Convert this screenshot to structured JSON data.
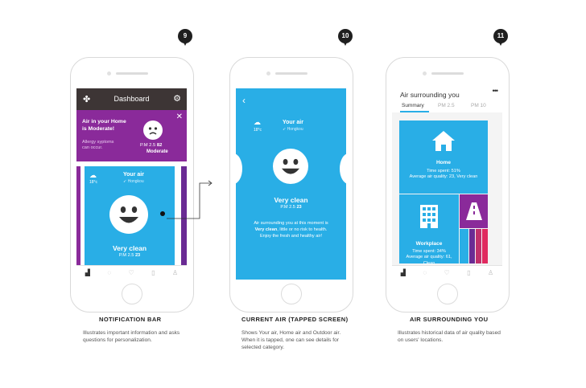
{
  "steps": {
    "s9": "9",
    "s10": "10",
    "s11": "11"
  },
  "screen1": {
    "header_title": "Dashboard",
    "notification": {
      "title": "Air in your Home is Moderate!",
      "body": "Allergy syptoms can occur.",
      "pm_label": "P.M 2.5",
      "pm_value": "82",
      "status": "Moderate"
    },
    "card": {
      "temp": "18°c",
      "label": "Your air",
      "location": "Hongkou",
      "status": "Very clean",
      "pm_label": "P.M 2.5",
      "pm_value": "23"
    }
  },
  "screen2": {
    "temp": "18°c",
    "label": "Your air",
    "location": "Hongkou",
    "status": "Very clean",
    "pm_label": "P.M 2.5",
    "pm_value": "23",
    "description_prefix": "Air surrounding you at this moment is",
    "description_bold": "Very clean",
    "description_suffix": ", little or no risk to health. Enjoy the fresh and healthy air!"
  },
  "screen3": {
    "title": "Air surrounding you",
    "tabs": [
      "Summary",
      "PM 2.5",
      "PM 10"
    ],
    "home": {
      "label": "Home",
      "time": "Time spent: 51%",
      "quality": "Average air quality: 23, Very clean"
    },
    "workplace": {
      "label": "Workplace",
      "time": "Time spent: 34%",
      "quality": "Average air quality: 61, Clean"
    }
  },
  "captions": [
    {
      "title": "NOTIFICATION BAR",
      "desc": "Illustrates important information and asks questions for personalization."
    },
    {
      "title": "CURRENT AIR (TAPPED SCREEN)",
      "desc": "Shows Your air, Home air and Outdoor air. When it is tapped, one can see details for selected category."
    },
    {
      "title": "AIR SURROUNDING YOU",
      "desc": "Illustrates historical data of air quality based on users' locations."
    }
  ],
  "colors": {
    "blue": "#29aee6",
    "purple": "#8a2a9a",
    "dark": "#3d3535"
  },
  "icons": [
    "chart-icon",
    "bulb-icon",
    "heart-icon",
    "phone-icon",
    "person-icon",
    "gear-icon",
    "close-icon",
    "back-icon",
    "cloud-icon",
    "location-icon",
    "house-icon",
    "building-icon",
    "road-icon",
    "more-icon"
  ]
}
